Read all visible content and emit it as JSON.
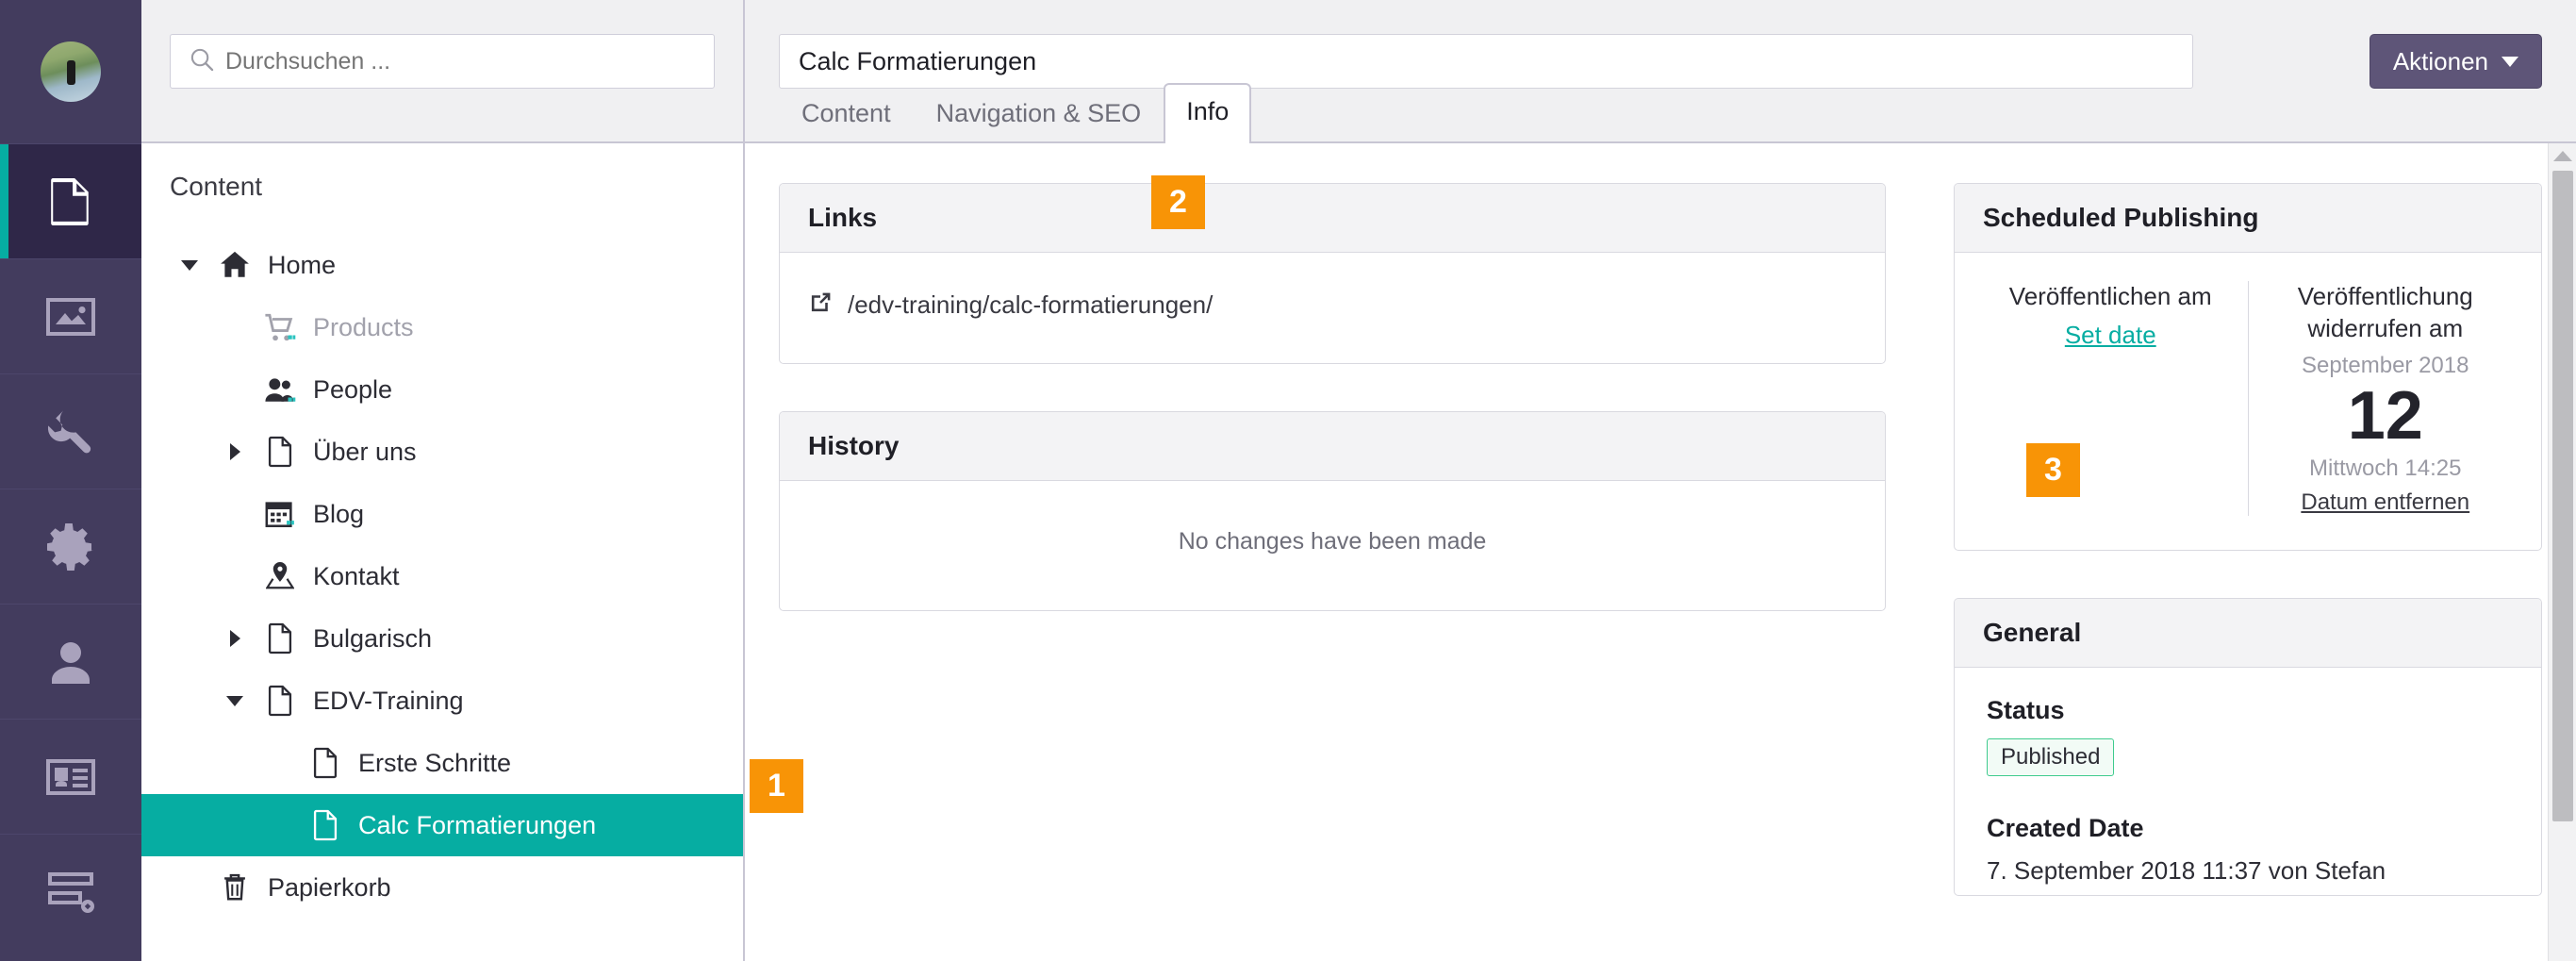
{
  "theme": {
    "sidebar_purple": "#433C5E",
    "sidebar_active_purple": "#2F2748",
    "accent_teal": "#06ADA2",
    "badge_orange": "#F89406",
    "status_green": "#3FCB8E"
  },
  "rail": {
    "avatar_name": "user-avatar",
    "items": [
      {
        "name": "content",
        "icon": "document-icon",
        "active": true
      },
      {
        "name": "media",
        "icon": "image-icon",
        "active": false
      },
      {
        "name": "settings-tools",
        "icon": "wrench-icon",
        "active": false
      },
      {
        "name": "configuration",
        "icon": "gear-icon",
        "active": false
      },
      {
        "name": "users",
        "icon": "user-icon",
        "active": false
      },
      {
        "name": "members",
        "icon": "id-card-icon",
        "active": false
      },
      {
        "name": "forms",
        "icon": "forms-icon",
        "active": false
      }
    ]
  },
  "search": {
    "placeholder": "Durchsuchen ...",
    "value": "",
    "icon": "search-icon"
  },
  "tree": {
    "title": "Content",
    "nodes": [
      {
        "label": "Home",
        "icon": "home-icon",
        "indent": 0,
        "caret": "down",
        "state": "published",
        "selected": false
      },
      {
        "label": "Products",
        "icon": "cart-icon",
        "indent": 1,
        "caret": "none",
        "state": "unpublished",
        "selected": false
      },
      {
        "label": "People",
        "icon": "people-icon",
        "indent": 1,
        "caret": "none",
        "state": "published",
        "selected": false
      },
      {
        "label": "Über uns",
        "icon": "document-icon",
        "indent": 1,
        "caret": "right",
        "state": "published",
        "selected": false
      },
      {
        "label": "Blog",
        "icon": "calendar-icon",
        "indent": 1,
        "caret": "none",
        "state": "published",
        "selected": false
      },
      {
        "label": "Kontakt",
        "icon": "map-pin-icon",
        "indent": 1,
        "caret": "none",
        "state": "published",
        "selected": false
      },
      {
        "label": "Bulgarisch",
        "icon": "document-icon",
        "indent": 1,
        "caret": "right",
        "state": "published",
        "selected": false
      },
      {
        "label": "EDV-Training",
        "icon": "document-icon",
        "indent": 1,
        "caret": "down",
        "state": "published",
        "selected": false
      },
      {
        "label": "Erste Schritte",
        "icon": "document-icon",
        "indent": 2,
        "caret": "none",
        "state": "published",
        "selected": false
      },
      {
        "label": "Calc Formatierungen",
        "icon": "document-icon",
        "indent": 2,
        "caret": "none",
        "state": "published",
        "selected": true
      },
      {
        "label": "Papierkorb",
        "icon": "trash-icon",
        "indent": 0,
        "caret": "none",
        "state": "published",
        "selected": false
      }
    ]
  },
  "header": {
    "title_value": "Calc Formatierungen",
    "title_placeholder": "Enter a name...",
    "actions_label": "Aktionen",
    "actions_caret_icon": "chevron-down-icon",
    "tabs": [
      {
        "label": "Content",
        "active": false
      },
      {
        "label": "Navigation & SEO",
        "active": false
      },
      {
        "label": "Info",
        "active": true
      }
    ]
  },
  "badges": [
    {
      "id": "badge-1",
      "label": "1"
    },
    {
      "id": "badge-2",
      "label": "2"
    },
    {
      "id": "badge-3",
      "label": "3"
    }
  ],
  "links_panel": {
    "heading": "Links",
    "icon": "external-link-icon",
    "url": "/edv-training/calc-formatierungen/"
  },
  "history_panel": {
    "heading": "History",
    "empty_text": "No changes have been made"
  },
  "scheduled_publishing": {
    "heading": "Scheduled Publishing",
    "publish_at": {
      "label": "Veröffentlichen am",
      "set_date_link": "Set date"
    },
    "unpublish_at": {
      "label": "Veröffentlichung widerrufen am",
      "month_year": "September 2018",
      "day": "12",
      "weekday_time": "Mittwoch 14:25",
      "remove_link": "Datum entfernen"
    }
  },
  "general_panel": {
    "heading": "General",
    "status_label": "Status",
    "status_value": "Published",
    "created_date_label": "Created Date",
    "created_date_value": "7. September 2018 11:37 von Stefan"
  },
  "scrollbar": {
    "arrow_icon": "caret-up-icon"
  }
}
